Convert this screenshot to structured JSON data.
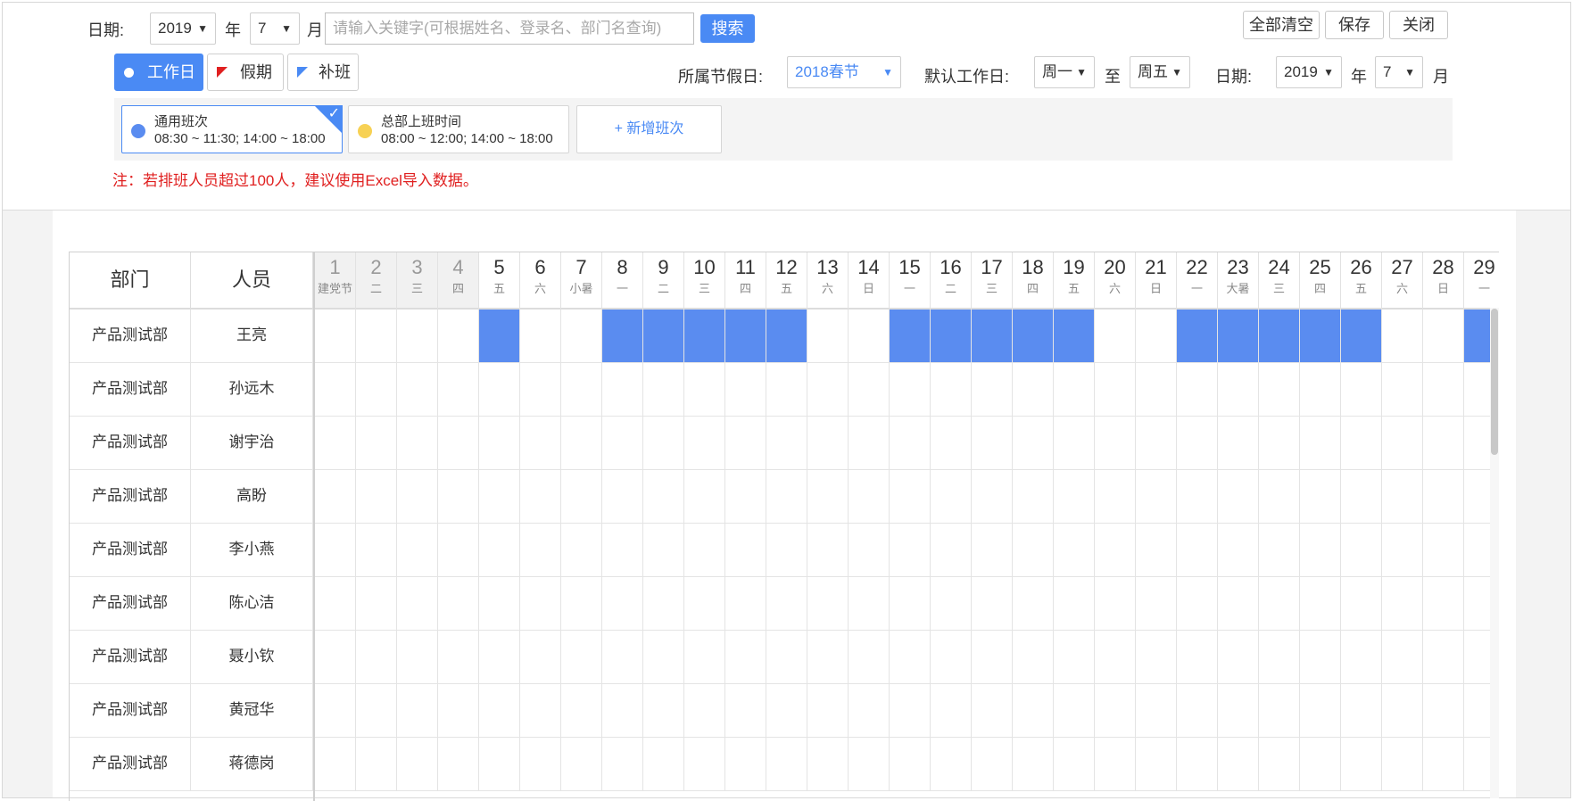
{
  "top_filter": {
    "date_label": "日期:",
    "year_value": "2019",
    "year_unit": "年",
    "month_value": "7",
    "month_unit": "月",
    "search_placeholder": "请输入关键字(可根据姓名、登录名、部门名查询)",
    "search_button": "搜索"
  },
  "actions": {
    "clear_all": "全部清空",
    "save": "保存",
    "close": "关闭"
  },
  "legend": {
    "workday": "工作日",
    "holiday": "假期",
    "makeup": "补班"
  },
  "settings": {
    "holiday_label": "所属节假日:",
    "holiday_value": "2018春节",
    "default_workday_label": "默认工作日:",
    "from_day": "周一",
    "to_label": "至",
    "to_day": "周五",
    "date_label": "日期:",
    "year_value": "2019",
    "year_unit": "年",
    "month_value": "7",
    "month_unit": "月"
  },
  "shifts": [
    {
      "name": "通用班次",
      "time": "08:30 ~ 11:30;   14:00 ~ 18:00",
      "color": "#5a8cf0",
      "selected": true
    },
    {
      "name": "总部上班时间",
      "time": "08:00 ~ 12:00;   14:00 ~ 18:00",
      "color": "#f7d154",
      "selected": false
    }
  ],
  "add_shift": "+ 新增班次",
  "note": "注：若排班人员超过100人，建议使用Excel导入数据。",
  "table": {
    "col_dept": "部门",
    "col_person": "人员",
    "days": [
      {
        "n": "1",
        "w": "建党节",
        "past": true
      },
      {
        "n": "2",
        "w": "二",
        "past": true
      },
      {
        "n": "3",
        "w": "三",
        "past": true
      },
      {
        "n": "4",
        "w": "四",
        "past": true
      },
      {
        "n": "5",
        "w": "五"
      },
      {
        "n": "6",
        "w": "六"
      },
      {
        "n": "7",
        "w": "小暑"
      },
      {
        "n": "8",
        "w": "一"
      },
      {
        "n": "9",
        "w": "二"
      },
      {
        "n": "10",
        "w": "三"
      },
      {
        "n": "11",
        "w": "四"
      },
      {
        "n": "12",
        "w": "五"
      },
      {
        "n": "13",
        "w": "六"
      },
      {
        "n": "14",
        "w": "日"
      },
      {
        "n": "15",
        "w": "一"
      },
      {
        "n": "16",
        "w": "二"
      },
      {
        "n": "17",
        "w": "三"
      },
      {
        "n": "18",
        "w": "四"
      },
      {
        "n": "19",
        "w": "五"
      },
      {
        "n": "20",
        "w": "六"
      },
      {
        "n": "21",
        "w": "日"
      },
      {
        "n": "22",
        "w": "一"
      },
      {
        "n": "23",
        "w": "大暑"
      },
      {
        "n": "24",
        "w": "三"
      },
      {
        "n": "25",
        "w": "四"
      },
      {
        "n": "26",
        "w": "五"
      },
      {
        "n": "27",
        "w": "六"
      },
      {
        "n": "28",
        "w": "日"
      },
      {
        "n": "29",
        "w": "一"
      }
    ],
    "rows": [
      {
        "dept": "产品测试部",
        "person": "王亮",
        "scheduled": [
          5,
          8,
          9,
          10,
          11,
          12,
          15,
          16,
          17,
          18,
          19,
          22,
          23,
          24,
          25,
          26,
          29
        ]
      },
      {
        "dept": "产品测试部",
        "person": "孙远木",
        "scheduled": []
      },
      {
        "dept": "产品测试部",
        "person": "谢宇治",
        "scheduled": []
      },
      {
        "dept": "产品测试部",
        "person": "高盼",
        "scheduled": []
      },
      {
        "dept": "产品测试部",
        "person": "李小燕",
        "scheduled": []
      },
      {
        "dept": "产品测试部",
        "person": "陈心洁",
        "scheduled": []
      },
      {
        "dept": "产品测试部",
        "person": "聂小钦",
        "scheduled": []
      },
      {
        "dept": "产品测试部",
        "person": "黄冠华",
        "scheduled": []
      },
      {
        "dept": "产品测试部",
        "person": "蒋德岗",
        "scheduled": []
      }
    ]
  }
}
